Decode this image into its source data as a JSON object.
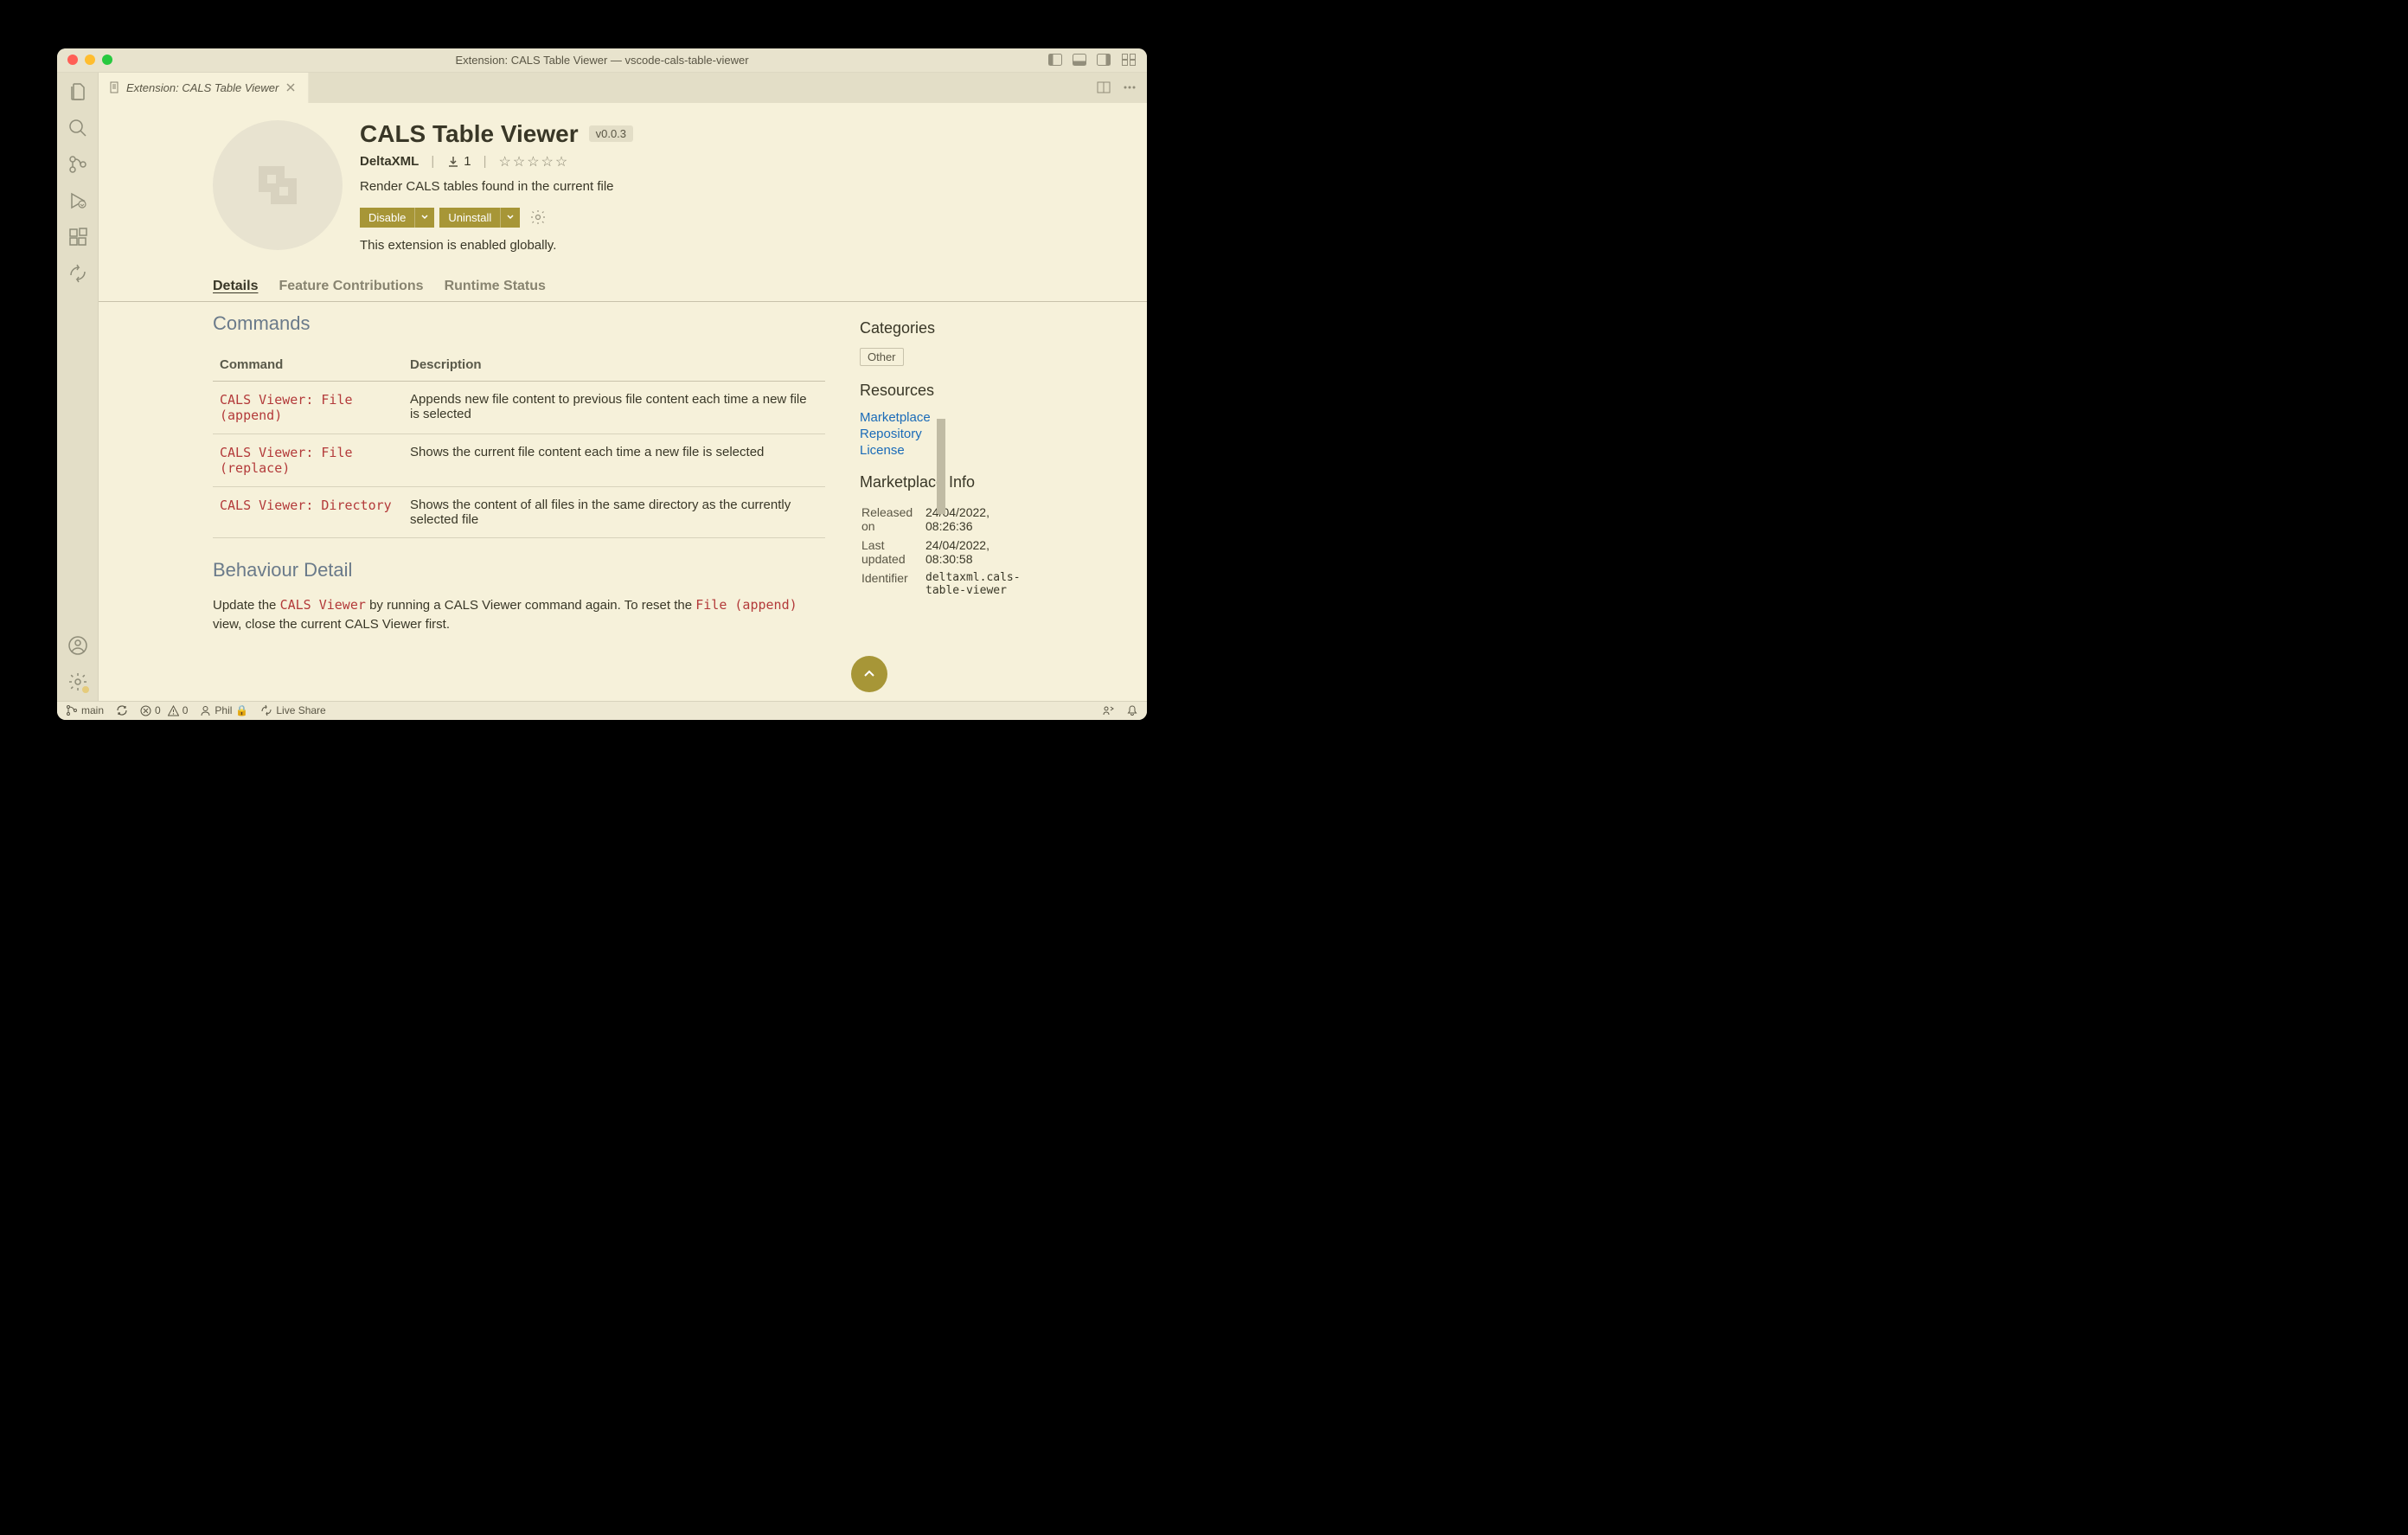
{
  "window": {
    "title": "Extension: CALS Table Viewer — vscode-cals-table-viewer"
  },
  "tab": {
    "label": "Extension: CALS Table Viewer"
  },
  "extension": {
    "name": "CALS Table Viewer",
    "version": "v0.0.3",
    "publisher": "DeltaXML",
    "install_count": "1",
    "description": "Render CALS tables found in the current file",
    "disable_label": "Disable",
    "uninstall_label": "Uninstall",
    "status_text": "This extension is enabled globally."
  },
  "nav_tabs": {
    "details": "Details",
    "features": "Feature Contributions",
    "runtime": "Runtime Status"
  },
  "commands": {
    "heading": "Commands",
    "col_command": "Command",
    "col_description": "Description",
    "rows": [
      {
        "name": "CALS Viewer: File (append)",
        "desc": "Appends new file content to previous file content each time a new file is selected"
      },
      {
        "name": "CALS Viewer: File (replace)",
        "desc": "Shows the current file content each time a new file is selected"
      },
      {
        "name": "CALS Viewer: Directory",
        "desc": "Shows the content of all files in the same directory as the currently selected file"
      }
    ]
  },
  "behavior": {
    "heading": "Behaviour Detail",
    "part1": "Update the ",
    "code1": "CALS Viewer",
    "part2": " by running a CALS Viewer command again. To reset the ",
    "code2": "File (append)",
    "part3": " view, close the current CALS Viewer first."
  },
  "sidebar": {
    "categories_heading": "Categories",
    "category_tag": "Other",
    "resources_heading": "Resources",
    "resources": {
      "marketplace": "Marketplace",
      "repository": "Repository",
      "license": "License"
    },
    "marketplace_heading": "Marketplace Info",
    "info": {
      "released_label": "Released on",
      "released_value": "24/04/2022, 08:26:36",
      "updated_label": "Last updated",
      "updated_value": "24/04/2022, 08:30:58",
      "identifier_label": "Identifier",
      "identifier_value": "deltaxml.cals-table-viewer"
    }
  },
  "statusbar": {
    "branch": "main",
    "errors": "0",
    "warnings": "0",
    "user": "Phil",
    "live_share": "Live Share"
  }
}
